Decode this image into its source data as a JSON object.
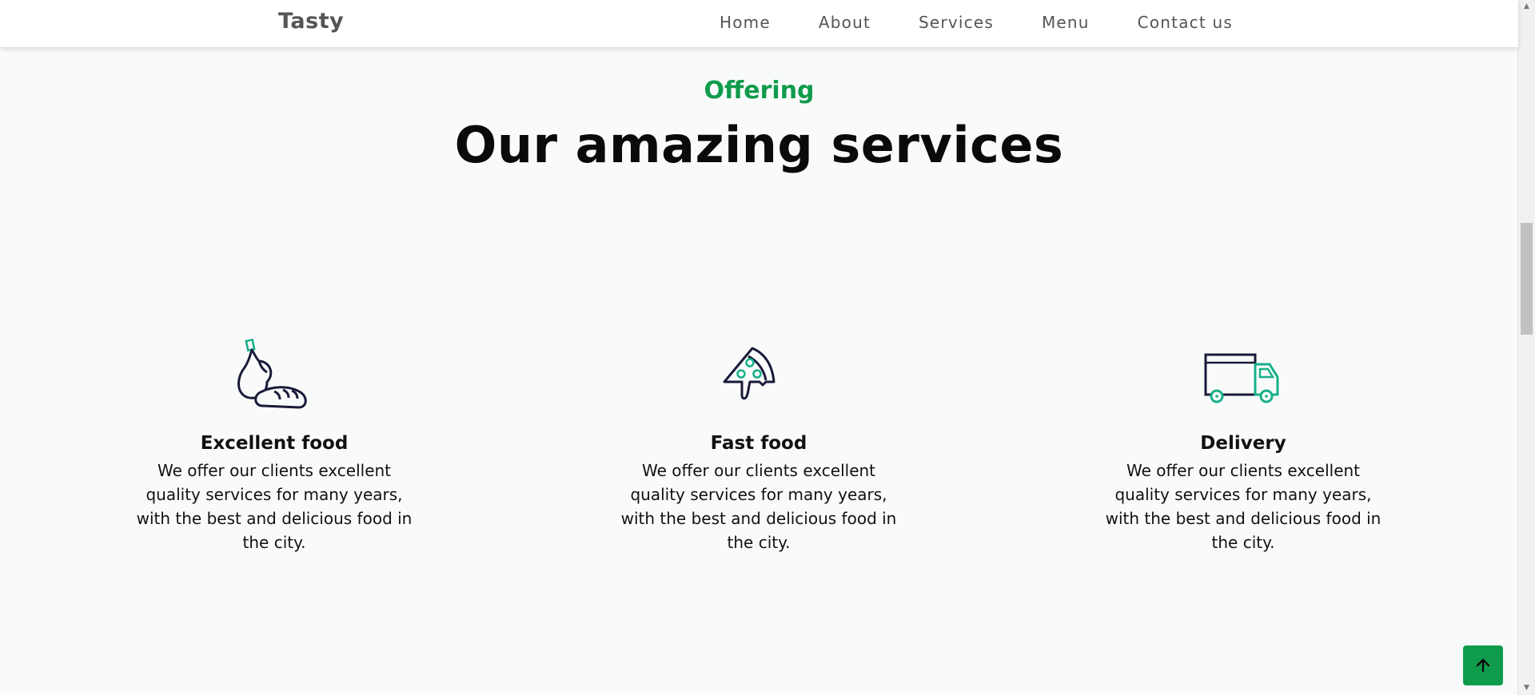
{
  "header": {
    "logo": "Tasty",
    "nav": [
      "Home",
      "About",
      "Services",
      "Menu",
      "Contact us"
    ]
  },
  "section": {
    "eyebrow": "Offering",
    "title": "Our amazing services"
  },
  "services": [
    {
      "icon": "food-icon",
      "name": "Excellent food",
      "description": "We offer our clients excellent quality services for many years, with the best and delicious food in the city."
    },
    {
      "icon": "pizza-icon",
      "name": "Fast food",
      "description": "We offer our clients excellent quality services for many years, with the best and delicious food in the city."
    },
    {
      "icon": "truck-icon",
      "name": "Delivery",
      "description": "We offer our clients excellent quality services for many years, with the best and delicious food in the city."
    }
  ],
  "scroll_top_icon": "arrow-up-icon",
  "colors": {
    "accent": "#0e9b4c",
    "icon_stroke": "#1b1a3a",
    "icon_accent": "#16b08a",
    "background": "#f9fbfa"
  }
}
